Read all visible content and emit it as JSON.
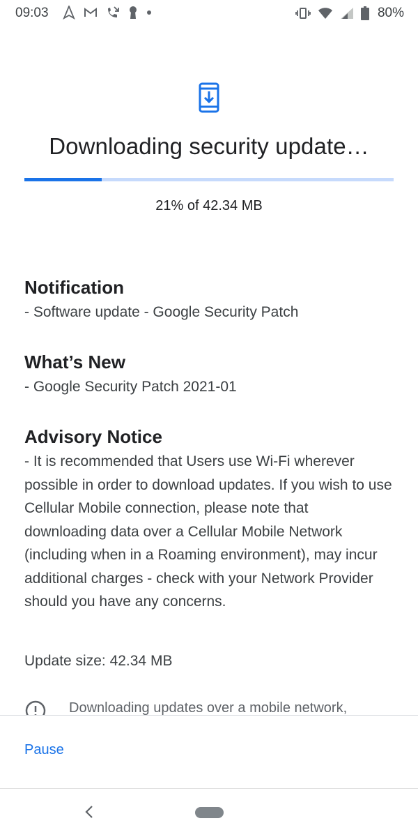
{
  "status_bar": {
    "time": "09:03",
    "left_icons": [
      "maps-navigation-icon",
      "gmail-icon",
      "missed-call-icon",
      "keyhole-icon",
      "dot-icon"
    ],
    "right_icons": [
      "vibrate-icon",
      "wifi-icon",
      "signal-icon",
      "battery-icon"
    ],
    "battery_percent": "80%"
  },
  "header": {
    "icon": "system-update-icon",
    "title": "Downloading security update…",
    "progress_fraction": 0.21,
    "progress_text": "21% of 42.34 MB"
  },
  "sections": [
    {
      "heading": "Notification",
      "body": "- Software update - Google Security Patch"
    },
    {
      "heading": "What’s New",
      "body": "- Google Security Patch 2021-01"
    },
    {
      "heading": "Advisory Notice",
      "body": "- It is recommended that Users use Wi-Fi wherever possible in order to download updates. If you wish to use Cellular Mobile connection, please note that downloading data over a Cellular Mobile Network (including when in a Roaming environment), may incur additional charges - check with your Network Provider should you have any concerns."
    }
  ],
  "update_size": "Update size: 42.34 MB",
  "warning": {
    "icon": "info-alert-icon",
    "text": "Downloading updates over a mobile network,"
  },
  "actions": {
    "pause_label": "Pause"
  },
  "nav_bar": {
    "back_icon": "back-chevron-icon",
    "home_icon": "home-pill-icon"
  },
  "colors": {
    "accent": "#1a73e8",
    "progress_track": "#c6dafc",
    "text_primary": "#202124",
    "text_secondary": "#3c4043"
  }
}
